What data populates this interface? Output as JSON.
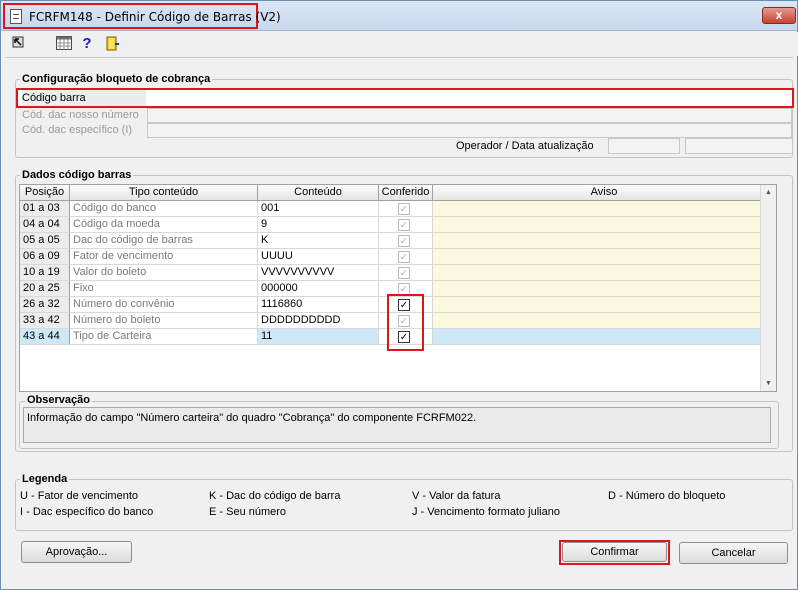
{
  "window": {
    "title": "FCRFM148 - Definir Código de Barras (V2)",
    "close_label": "x"
  },
  "config": {
    "legend": "Configuração bloqueto de cobrança",
    "codigo_barra_label": "Código barra",
    "codigo_barra_value": "",
    "cod_dac_nosso_numero_label": "Cód. dac nosso número",
    "cod_dac_especifico_label": "Cód. dac específico (I)",
    "operador_label": "Operador / Data atualização"
  },
  "dados": {
    "legend": "Dados código barras",
    "columns": [
      "Posição",
      "Tipo conteúdo",
      "Conteúdo",
      "Conferido",
      "Aviso"
    ],
    "rows": [
      {
        "posicao": "01 a 03",
        "tipo": "Código do banco",
        "conteudo": "001",
        "conferido": true,
        "enabled": false,
        "aviso": ""
      },
      {
        "posicao": "04 a 04",
        "tipo": "Código da moeda",
        "conteudo": "9",
        "conferido": true,
        "enabled": false,
        "aviso": ""
      },
      {
        "posicao": "05 a 05",
        "tipo": "Dac do código de barras",
        "conteudo": "K",
        "conferido": true,
        "enabled": false,
        "aviso": ""
      },
      {
        "posicao": "06 a 09",
        "tipo": "Fator de vencimento",
        "conteudo": "UUUU",
        "conferido": true,
        "enabled": false,
        "aviso": ""
      },
      {
        "posicao": "10 a 19",
        "tipo": "Valor do boleto",
        "conteudo": "VVVVVVVVVV",
        "conferido": true,
        "enabled": false,
        "aviso": ""
      },
      {
        "posicao": "20 a 25",
        "tipo": "Fixo",
        "conteudo": "000000",
        "conferido": true,
        "enabled": false,
        "aviso": ""
      },
      {
        "posicao": "26 a 32",
        "tipo": "Número do convênio",
        "conteudo": "1116860",
        "conferido": true,
        "enabled": true,
        "aviso": ""
      },
      {
        "posicao": "33 a 42",
        "tipo": "Número do boleto",
        "conteudo": "DDDDDDDDDD",
        "conferido": true,
        "enabled": false,
        "aviso": ""
      },
      {
        "posicao": "43 a 44",
        "tipo": "Tipo de Carteira",
        "conteudo": "11",
        "conferido": true,
        "enabled": true,
        "aviso": ""
      }
    ]
  },
  "observacao": {
    "legend": "Observação",
    "text": "Informação do campo \"Número carteira\" do quadro \"Cobrança\" do componente FCRFM022."
  },
  "legenda": {
    "legend": "Legenda",
    "items": [
      "U - Fator de vencimento",
      "K - Dac do código de barra",
      "V - Valor da fatura",
      "D - Número do bloqueto",
      "I - Dac específico do banco",
      "E - Seu número",
      "J - Vencimento formato juliano"
    ]
  },
  "buttons": {
    "aprovacao": "Aprovação...",
    "confirmar": "Confirmar",
    "cancelar": "Cancelar"
  },
  "colors": {
    "highlight": "#e0141c",
    "aviso_bg": "#fbf8dd",
    "selected_row": "#cde8f6"
  },
  "icons": [
    "arrow-icon",
    "calendar-grid-icon",
    "help-icon",
    "exit-door-icon"
  ]
}
